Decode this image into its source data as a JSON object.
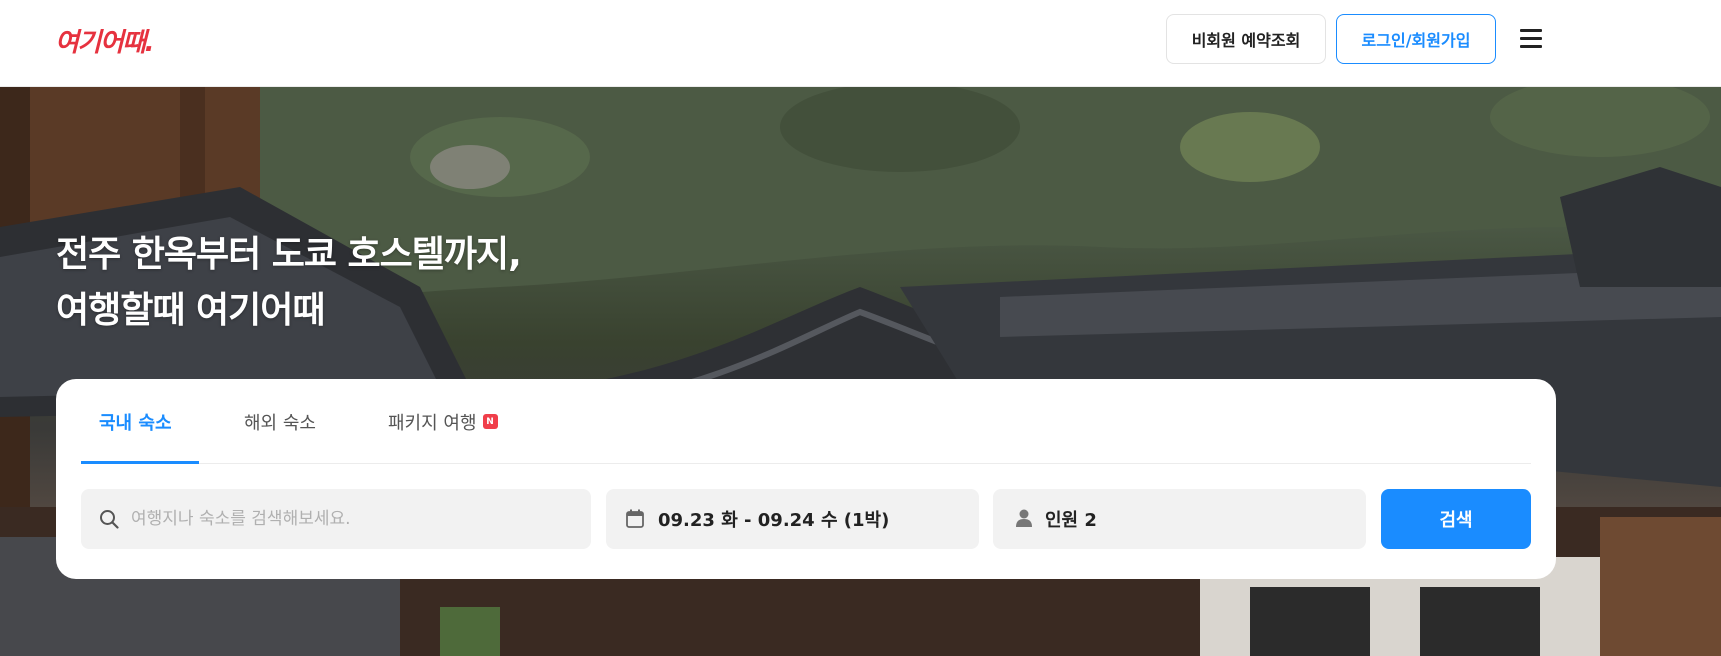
{
  "header": {
    "logo_text": "여기어때.",
    "guest_reservation_label": "비회원 예약조회",
    "login_label": "로그인/회원가입",
    "menu_icon": "hamburger-menu-icon"
  },
  "hero": {
    "title_line1": "전주 한옥부터 도쿄 호스텔까지,",
    "title_line2": "여행할때 여기어때"
  },
  "search": {
    "tabs": [
      {
        "label": "국내 숙소",
        "active": true
      },
      {
        "label": "해외 숙소",
        "active": false
      },
      {
        "label": "패키지 여행",
        "active": false,
        "badge": "N"
      }
    ],
    "placeholder": "여행지나 숙소를 검색해보세요.",
    "date_text": "09.23 화 - 09.24 수 (1박)",
    "people_text": "인원 2",
    "search_button_label": "검색"
  },
  "colors": {
    "brand_red": "#e6323f",
    "accent_blue": "#1a8cff",
    "badge_red": "#f03e4a"
  }
}
